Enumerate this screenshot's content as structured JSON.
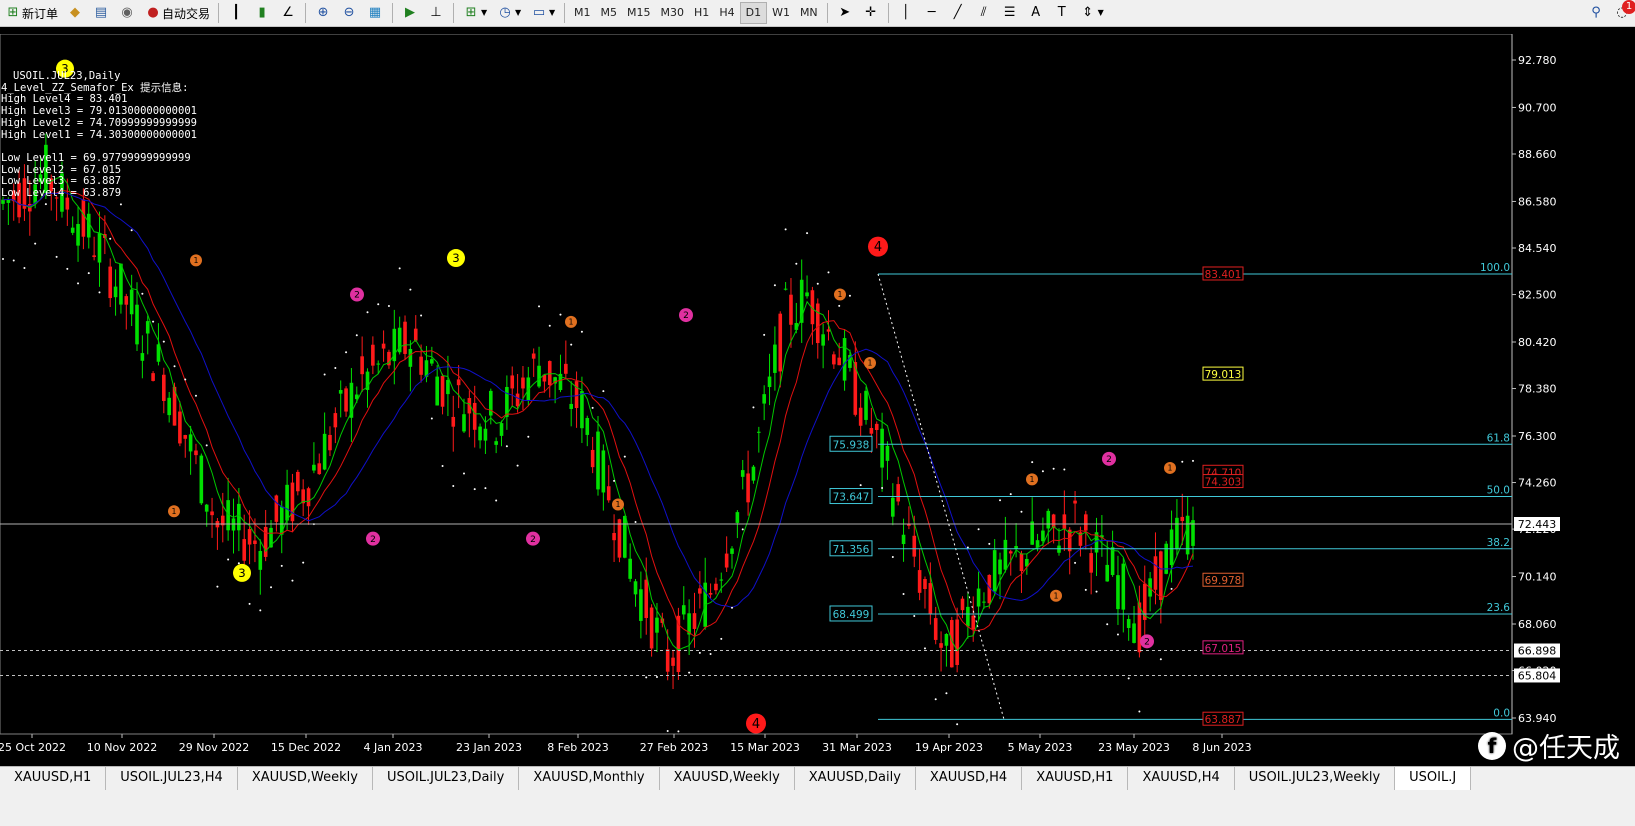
{
  "toolbar": {
    "new_order": "新订单",
    "auto_trade": "自动交易",
    "timeframes": [
      "M1",
      "M5",
      "M15",
      "M30",
      "H1",
      "H4",
      "D1",
      "W1",
      "MN"
    ],
    "active_timeframe": "D1",
    "alert_count": "1"
  },
  "chart": {
    "symbol_title": "USOIL.JUL23,Daily",
    "indicator_info": "4_Level_ZZ_Semafor_Ex 提示信息:",
    "levels": [
      "High Level4 = 83.401",
      "High Level3 = 79.01300000000001",
      "High Level2 = 74.70999999999999",
      "High Level1 = 74.30300000000001",
      "",
      "Low Level1 = 69.97799999999999",
      "Low Level2 = 67.015",
      "Low Level3 = 63.887",
      "Low Level4 = 63.879"
    ],
    "price_axis": [
      "92.780",
      "90.700",
      "88.660",
      "86.580",
      "84.540",
      "82.500",
      "80.420",
      "78.380",
      "76.300",
      "74.260",
      "72.220",
      "70.140",
      "68.060",
      "66.020",
      "63.940"
    ],
    "current_price": "72.443",
    "marked_prices": [
      "66.898",
      "65.804"
    ],
    "date_axis": [
      "25 Oct 2022",
      "10 Nov 2022",
      "29 Nov 2022",
      "15 Dec 2022",
      "4 Jan 2023",
      "23 Jan 2023",
      "8 Feb 2023",
      "27 Feb 2023",
      "15 Mar 2023",
      "31 Mar 2023",
      "19 Apr 2023",
      "5 May 2023",
      "23 May 2023",
      "8 Jun 2023"
    ],
    "fib_levels": [
      {
        "pct": "100.0",
        "price": 83.401
      },
      {
        "pct": "61.8",
        "price": 75.938
      },
      {
        "pct": "50.0",
        "price": 73.647
      },
      {
        "pct": "38.2",
        "price": 71.356
      },
      {
        "pct": "23.6",
        "price": 68.499
      },
      {
        "pct": "0.0",
        "price": 63.879
      }
    ],
    "fib_price_labels": [
      "75.938",
      "73.647",
      "71.356",
      "68.499"
    ],
    "semafor_labels": [
      {
        "text": "83.401",
        "color": "#e02020"
      },
      {
        "text": "79.013",
        "color": "#ffff40"
      },
      {
        "text": "74.710",
        "color": "#e02020"
      },
      {
        "text": "74.303",
        "color": "#e02020"
      },
      {
        "text": "69.978",
        "color": "#e06030"
      },
      {
        "text": "67.015",
        "color": "#e02080"
      },
      {
        "text": "63.887",
        "color": "#e02020"
      }
    ],
    "colors": {
      "background": "#000000",
      "bull": "#00e000",
      "bear": "#ff1a1a",
      "ma_fast": "#00c800",
      "ma_mid": "#e01010",
      "ma_slow": "#1010c8",
      "fib": "#40c8d8",
      "sar": "#ffffff"
    }
  },
  "tabs": [
    "XAUUSD,H1",
    "USOIL.JUL23,H4",
    "XAUUSD,Weekly",
    "USOIL.JUL23,Daily",
    "XAUUSD,Monthly",
    "XAUUSD,Weekly",
    "XAUUSD,Daily",
    "XAUUSD,H4",
    "XAUUSD,H1",
    "XAUUSD,H4",
    "USOIL.JUL23,Weekly",
    "USOIL.J"
  ],
  "active_tab": 11,
  "watermark": "@任天成"
}
